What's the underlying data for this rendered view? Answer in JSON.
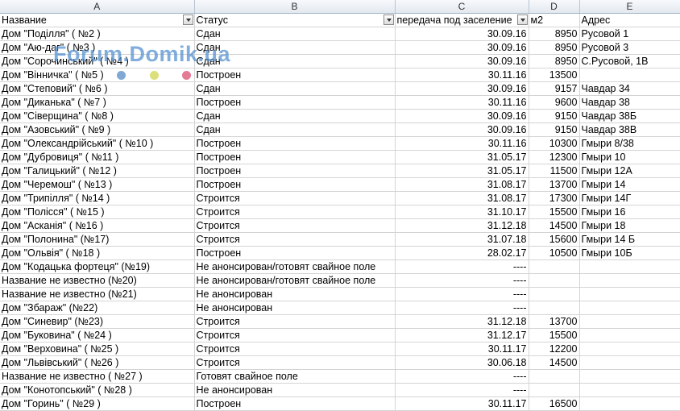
{
  "columns": [
    "A",
    "B",
    "C",
    "D",
    "E"
  ],
  "header": {
    "name": "Название",
    "status": "Статус",
    "date": "передача под заселение",
    "area": "м2",
    "address": "Адрес"
  },
  "watermark": "Forum.Domik.ua",
  "rows": [
    {
      "name": "Дом \"Поділля\" ( №2 )",
      "status": "Сдан",
      "date": "30.09.16",
      "area": "8950",
      "address": "Русовой 1"
    },
    {
      "name": "Дом \"Аю-даг\" ( №3 )",
      "status": "Сдан",
      "date": "30.09.16",
      "area": "8950",
      "address": "Русовой 3"
    },
    {
      "name": "Дом \"Сорочинський\" ( №4 )",
      "status": "Сдан",
      "date": "30.09.16",
      "area": "8950",
      "address": "С.Русовой, 1В"
    },
    {
      "name": "Дом \"Вінничка\" ( №5 )",
      "status": "Построен",
      "date": "30.11.16",
      "area": "13500",
      "address": ""
    },
    {
      "name": "Дом \"Степовий\" ( №6 )",
      "status": "Сдан",
      "date": "30.09.16",
      "area": "9157",
      "address": "Чавдар 34"
    },
    {
      "name": "Дом \"Диканька\" ( №7 )",
      "status": "Построен",
      "date": "30.11.16",
      "area": "9600",
      "address": "Чавдар 38"
    },
    {
      "name": "Дом \"Сіверщина\" ( №8 )",
      "status": "Сдан",
      "date": "30.09.16",
      "area": "9150",
      "address": "Чавдар 38Б"
    },
    {
      "name": "Дом \"Азовський\" ( №9 )",
      "status": "Сдан",
      "date": "30.09.16",
      "area": "9150",
      "address": "Чавдар 38В"
    },
    {
      "name": "Дом \"Олександрійський\" ( №10 )",
      "status": "Построен",
      "date": "30.11.16",
      "area": "10300",
      "address": "Гмыри 8/38"
    },
    {
      "name": "Дом \"Дубровиця\" ( №11 )",
      "status": "Построен",
      "date": "31.05.17",
      "area": "12300",
      "address": "Гмыри 10"
    },
    {
      "name": "Дом \"Галицький\" ( №12 )",
      "status": "Построен",
      "date": "31.05.17",
      "area": "11500",
      "address": "Гмыри 12А"
    },
    {
      "name": "Дом \"Черемош\" ( №13 )",
      "status": "Построен",
      "date": "31.08.17",
      "area": "13700",
      "address": "Гмыри 14"
    },
    {
      "name": "Дом \"Трипілля\" ( №14 )",
      "status": "Строится",
      "date": "31.08.17",
      "area": "17300",
      "address": "Гмыри 14Г"
    },
    {
      "name": "Дом \"Полісся\" ( №15 )",
      "status": "Строится",
      "date": "31.10.17",
      "area": "15500",
      "address": "Гмыри 16"
    },
    {
      "name": "Дом \"Асканія\" ( №16 )",
      "status": "Строится",
      "date": "31.12.18",
      "area": "14500",
      "address": "Гмыри 18"
    },
    {
      "name": "Дом \"Полонина\" (№17)",
      "status": "Строится",
      "date": "31.07.18",
      "area": "15600",
      "address": "Гмыри 14 Б"
    },
    {
      "name": "Дом \"Ольвія\" ( №18 )",
      "status": "Построен",
      "date": "28.02.17",
      "area": "10500",
      "address": "Гмыри 10Б"
    },
    {
      "name": "Дом \"Кодацька фортеця\" (№19)",
      "status": "Не анонсирован/готовят свайное поле",
      "date": "----",
      "area": "",
      "address": ""
    },
    {
      "name": "Название не известно (№20)",
      "status": "Не анонсирован/готовят свайное поле",
      "date": "----",
      "area": "",
      "address": ""
    },
    {
      "name": "Название не известно  (№21)",
      "status": "Не анонсирован",
      "date": "----",
      "area": "",
      "address": ""
    },
    {
      "name": "Дом \"Збараж\" (№22)",
      "status": "Не анонсирован",
      "date": "----",
      "area": "",
      "address": ""
    },
    {
      "name": "Дом \"Синевир\" (№23)",
      "status": "Строится",
      "date": "31.12.18",
      "area": "13700",
      "address": ""
    },
    {
      "name": "Дом \"Буковина\" ( №24 )",
      "status": "Строится",
      "date": "31.12.17",
      "area": "15500",
      "address": ""
    },
    {
      "name": "Дом \"Верховина\" ( №25 )",
      "status": "Строится",
      "date": "30.11.17",
      "area": "12200",
      "address": ""
    },
    {
      "name": "Дом \"Львівський\" ( №26 )",
      "status": "Строится",
      "date": "30.06.18",
      "area": "14500",
      "address": ""
    },
    {
      "name": "Название не известно ( №27 )",
      "status": "Готовят свайное поле",
      "date": "----",
      "area": "",
      "address": ""
    },
    {
      "name": "Дом \"Конотопський\" ( №28 )",
      "status": "Не анонсирован",
      "date": "----",
      "area": "",
      "address": ""
    },
    {
      "name": "Дом \"Горинь\" ( №29 )",
      "status": "Построен",
      "date": "30.11.17",
      "area": "16500",
      "address": ""
    }
  ]
}
